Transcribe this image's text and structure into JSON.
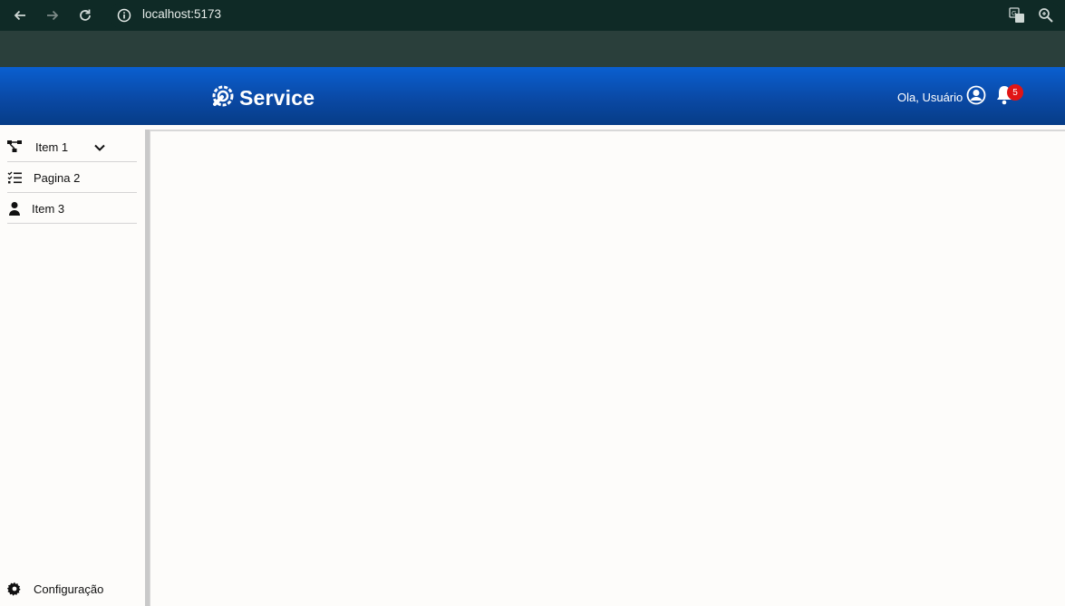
{
  "browser": {
    "url": "localhost:5173",
    "icons": [
      "back-arrow-icon",
      "forward-arrow-icon",
      "reload-icon",
      "site-info-icon",
      "translate-icon",
      "zoom-icon"
    ]
  },
  "header": {
    "brand": "Service",
    "greeting": "Ola, Usuário",
    "notification_count": "5",
    "colors": {
      "top": "#0a5fd0",
      "bottom": "#063c86",
      "badge": "#e01515"
    }
  },
  "sidebar": {
    "items": [
      {
        "label": "Item 1",
        "icon": "hierarchy-icon",
        "expandable": true
      },
      {
        "label": "Pagina 2",
        "icon": "checklist-icon",
        "expandable": false
      },
      {
        "label": "Item 3",
        "icon": "person-icon",
        "expandable": false
      }
    ],
    "footer": {
      "label": "Configuração",
      "icon": "gear-icon"
    }
  }
}
